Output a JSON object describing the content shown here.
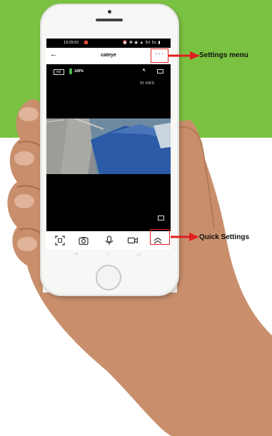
{
  "status_bar": {
    "time": "13:25:01",
    "icons": "⏰ ❁ ◉ ▲ 5il 5x ▮"
  },
  "app_bar": {
    "title": "cateye",
    "back_icon": "arrow-left-icon",
    "more_icon": "more-horizontal-icon"
  },
  "overlay": {
    "hd_badge": "HD",
    "battery": "100%",
    "speed": "55 KB/S"
  },
  "controls": {
    "icons": [
      "screenshot-icon",
      "camera-icon",
      "microphone-icon",
      "video-record-icon",
      "chevron-up-double-icon"
    ]
  },
  "android_nav": {
    "menu": "≡",
    "home": "○",
    "back": "◁"
  },
  "annotations": {
    "settings_label": "Settings menu",
    "quick_settings_label": "Quick Settings",
    "highlight_color": "#e02020",
    "arrow_color": "#e02020"
  },
  "colors": {
    "background_band": "#7cc242",
    "screen": "#000000"
  }
}
